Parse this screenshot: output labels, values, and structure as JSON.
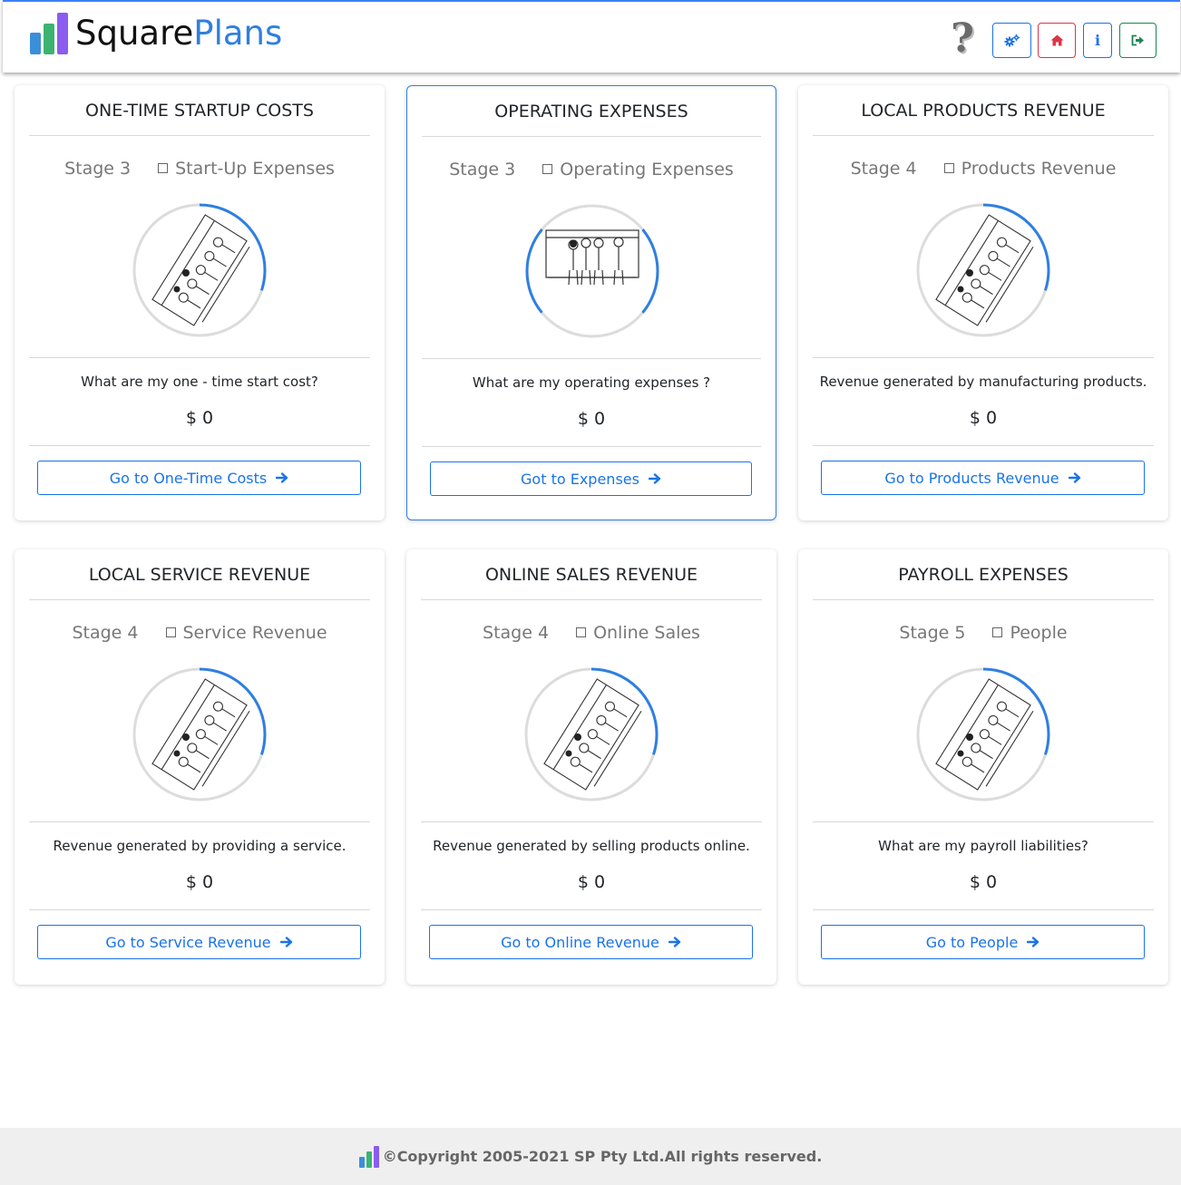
{
  "header": {
    "brand_part1": "Square",
    "brand_part2": "Plans",
    "help_glyph": "?",
    "buttons": {
      "settings_icon": "gears-icon",
      "home_icon": "home-icon",
      "info_glyph": "i",
      "logout_icon": "sign-out-icon"
    },
    "colors": {
      "accent": "#1a73e8",
      "danger": "#dc3545",
      "success": "#198754",
      "brand_blue": "#2f7fe0"
    }
  },
  "cards": [
    {
      "title": "ONE-TIME STARTUP COSTS",
      "stage": "Stage 3",
      "category": "Start-Up Expenses",
      "description": "What are my one - time start cost?",
      "amount": "$ 0",
      "button": "Go to One-Time Costs",
      "image": "office-group-sketch"
    },
    {
      "title": "OPERATING EXPENSES",
      "stage": "Stage 3",
      "category": "Operating Expenses",
      "description": "What are my operating expenses ?",
      "amount": "$ 0",
      "button": "Got to Expenses",
      "image": "business-team-sketch"
    },
    {
      "title": "LOCAL PRODUCTS REVENUE",
      "stage": "Stage 4",
      "category": "Products Revenue",
      "description": "Revenue generated by manufacturing products.",
      "amount": "$ 0",
      "button": "Go to Products Revenue",
      "image": "office-group-sketch"
    },
    {
      "title": "LOCAL SERVICE REVENUE",
      "stage": "Stage 4",
      "category": "Service Revenue",
      "description": "Revenue generated by providing a service.",
      "amount": "$ 0",
      "button": "Go to Service Revenue",
      "image": "office-group-sketch"
    },
    {
      "title": "ONLINE SALES REVENUE",
      "stage": "Stage 4",
      "category": "Online Sales",
      "description": "Revenue generated by selling products online.",
      "amount": "$ 0",
      "button": "Go to Online Revenue",
      "image": "office-group-sketch"
    },
    {
      "title": "PAYROLL EXPENSES",
      "stage": "Stage 5",
      "category": "People",
      "description": "What are my payroll liabilities?",
      "amount": "$ 0",
      "button": "Go to People",
      "image": "office-group-sketch"
    }
  ],
  "footer": {
    "copyright": "©Copyright 2005-2021 SP Pty Ltd.All rights reserved."
  }
}
